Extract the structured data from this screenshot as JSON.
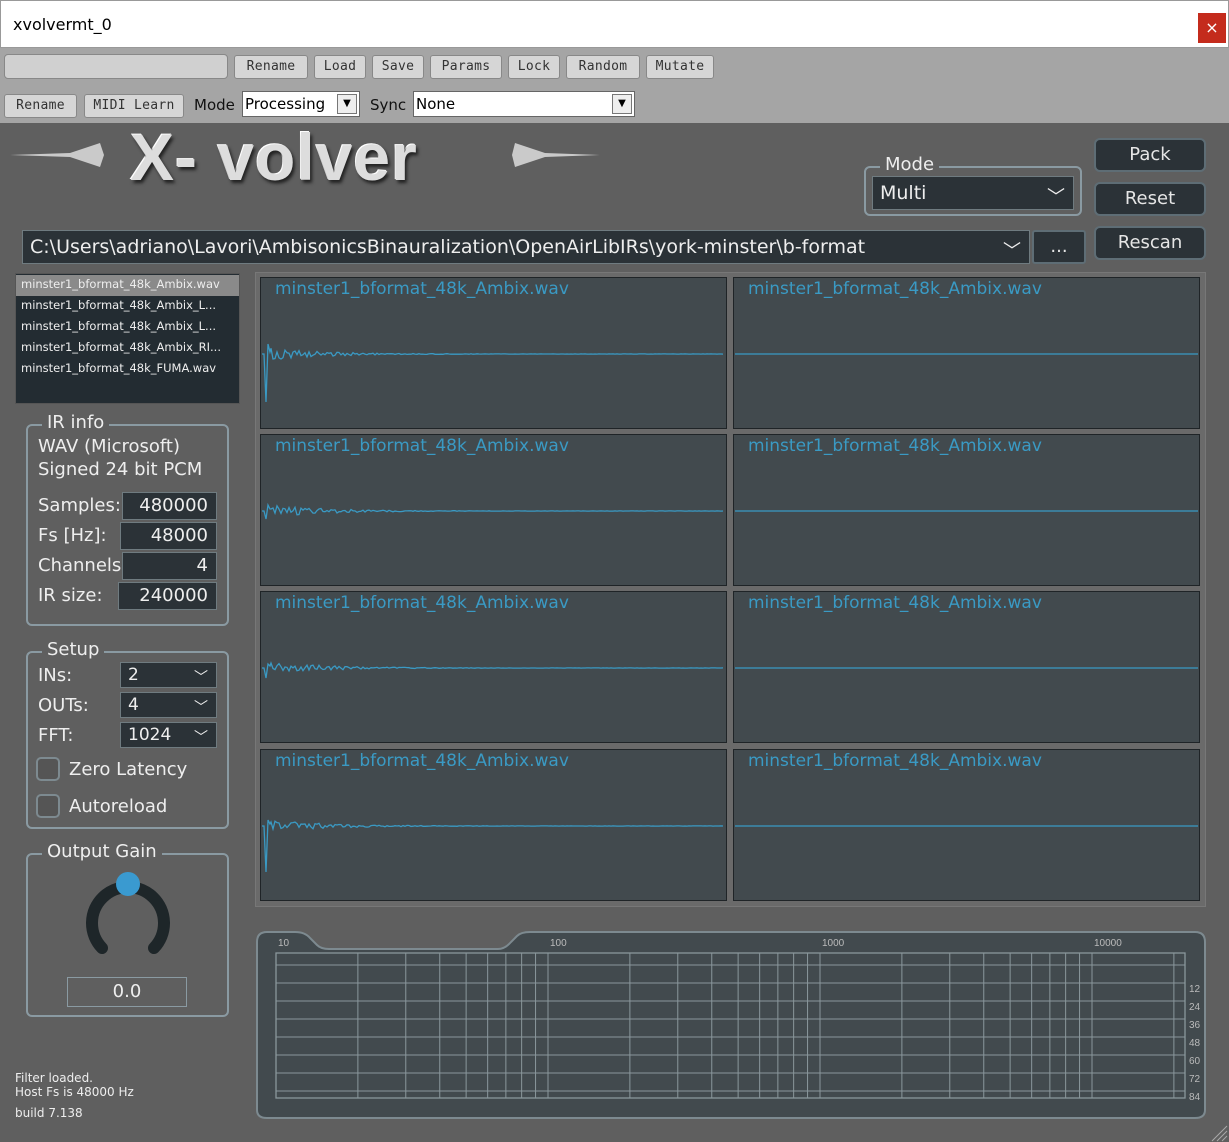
{
  "window": {
    "title": "xvolvermt_0",
    "close_label": "×"
  },
  "host_toolbar": {
    "preset_name": "",
    "row1_buttons": [
      "Rename",
      "Load",
      "Save",
      "Params",
      "Lock",
      "Random",
      "Mutate"
    ],
    "row2_buttons": [
      "Rename",
      "MIDI Learn"
    ],
    "mode_label": "Mode",
    "mode_value": "Processing",
    "sync_label": "Sync",
    "sync_value": "None"
  },
  "plugin": {
    "logo_text": "X- volver",
    "mode_group": {
      "title": "Mode",
      "value": "Multi"
    },
    "buttons": {
      "pack": "Pack",
      "reset": "Reset",
      "rescan": "Rescan",
      "browse": "..."
    },
    "path": "C:\\Users\\adriano\\Lavori\\AmbisonicsBinauralization\\OpenAirLibIRs\\york-minster\\b-format",
    "files": [
      {
        "name": "minster1_bformat_48k_Ambix.wav",
        "selected": true
      },
      {
        "name": "minster1_bformat_48k_Ambix_L...",
        "selected": false
      },
      {
        "name": "minster1_bformat_48k_Ambix_L...",
        "selected": false
      },
      {
        "name": "minster1_bformat_48k_Ambix_RI...",
        "selected": false
      },
      {
        "name": "minster1_bformat_48k_FUMA.wav",
        "selected": false
      }
    ],
    "ir_info": {
      "title": "IR info",
      "format": "WAV (Microsoft)",
      "encoding": "Signed 24 bit PCM",
      "samples_label": "Samples:",
      "samples": "480000",
      "fs_label": "Fs [Hz]:",
      "fs": "48000",
      "channels_label": "Channels:",
      "channels": "4",
      "irsize_label": "IR size:",
      "irsize": "240000"
    },
    "setup": {
      "title": "Setup",
      "ins_label": "INs:",
      "ins": "2",
      "outs_label": "OUTs:",
      "outs": "4",
      "fft_label": "FFT:",
      "fft": "1024",
      "zero_latency_label": "Zero Latency",
      "zero_latency": false,
      "autoreload_label": "Autoreload",
      "autoreload": false
    },
    "output_gain": {
      "title": "Output Gain",
      "value": "0.0",
      "knob_fraction": 0.5
    },
    "status": {
      "line1": "Filter loaded.",
      "line2": "Host Fs is 48000 Hz",
      "build": "build 7.138"
    },
    "waveforms": [
      "minster1_bformat_48k_Ambix.wav",
      "minster1_bformat_48k_Ambix.wav",
      "minster1_bformat_48k_Ambix.wav",
      "minster1_bformat_48k_Ambix.wav",
      "minster1_bformat_48k_Ambix.wav",
      "minster1_bformat_48k_Ambix.wav",
      "minster1_bformat_48k_Ambix.wav",
      "minster1_bformat_48k_Ambix.wav"
    ],
    "spectrum": {
      "x_ticks": [
        "10",
        "100",
        "1000",
        "10000"
      ],
      "y_ticks": [
        "12",
        "24",
        "36",
        "48",
        "60",
        "72",
        "84"
      ],
      "x_scale": "log"
    }
  },
  "colors": {
    "accent": "#3a9ac4",
    "panel": "#424a4e",
    "background": "#5f5f5f"
  }
}
